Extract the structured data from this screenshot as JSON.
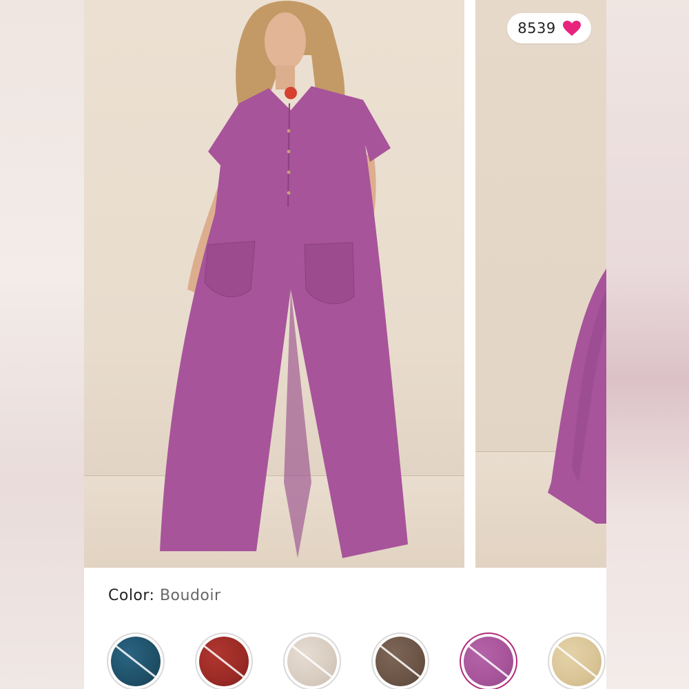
{
  "product": {
    "likes_count": "8539",
    "color_label": "Color:",
    "color_value": "Boudoir"
  },
  "icons": {
    "like": "heart-icon"
  },
  "swatches": [
    {
      "name": "teal",
      "color": "#1f5068",
      "sold_out": true,
      "selected": false
    },
    {
      "name": "red",
      "color": "#9a2a25",
      "sold_out": true,
      "selected": false
    },
    {
      "name": "cream",
      "color": "#d8ccc0",
      "sold_out": true,
      "selected": false
    },
    {
      "name": "brown",
      "color": "#6b5446",
      "sold_out": true,
      "selected": false
    },
    {
      "name": "boudoir",
      "color": "#a7549a",
      "sold_out": true,
      "selected": true
    },
    {
      "name": "tan",
      "color": "#d9c496",
      "sold_out": true,
      "selected": false
    }
  ],
  "colors": {
    "heart": "#e8237d",
    "jumpsuit": "#a7549a",
    "selected_ring": "#b22a7a"
  }
}
